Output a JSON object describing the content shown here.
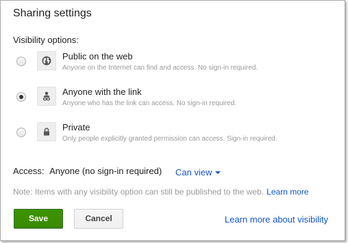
{
  "dialog": {
    "title": "Sharing settings",
    "visibility_label": "Visibility options:"
  },
  "options": [
    {
      "title": "Public on the web",
      "description": "Anyone on the Internet can find and access. No sign-in required.",
      "icon": "globe-icon",
      "selected": false
    },
    {
      "title": "Anyone with the link",
      "description": "Anyone who has the link can access. No sign-in required.",
      "icon": "person-link-icon",
      "selected": true
    },
    {
      "title": "Private",
      "description": "Only people explicitly granted permission can access. Sign-in required.",
      "icon": "lock-icon",
      "selected": false
    }
  ],
  "access": {
    "label": "Access:",
    "value": "Anyone (no sign-in required)",
    "permission": "Can view"
  },
  "note": {
    "text": "Note: Items with any visibility option can still be published to the web.",
    "link": "Learn more"
  },
  "buttons": {
    "save": "Save",
    "cancel": "Cancel"
  },
  "footer_link": "Learn more about visibility",
  "colors": {
    "link": "#1155cc",
    "save_button": "#3d9400",
    "muted_text": "#999999"
  }
}
